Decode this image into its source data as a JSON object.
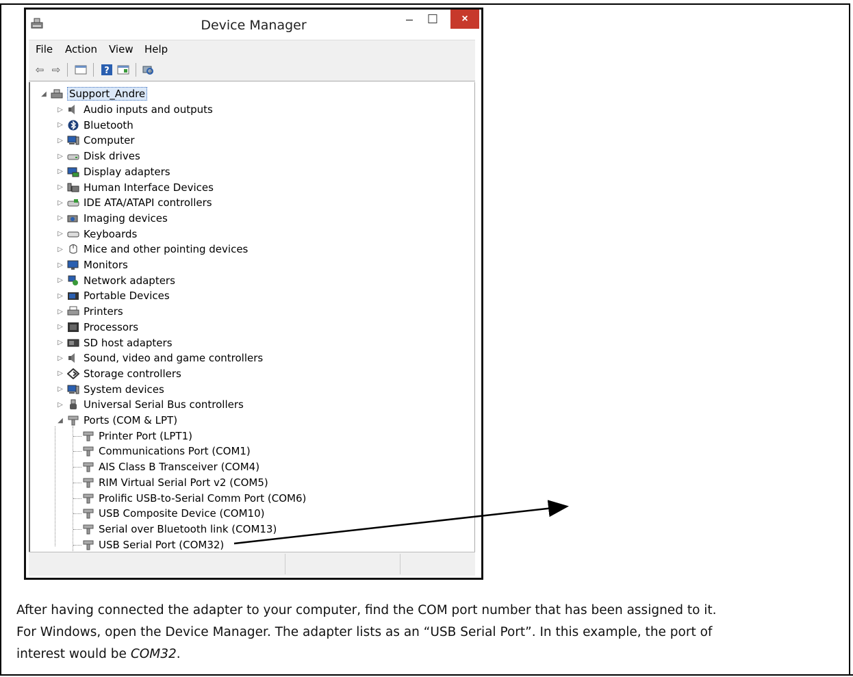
{
  "window": {
    "title": "Device Manager",
    "buttons": {
      "minimize": "–",
      "maximize": "☐",
      "close": "×"
    }
  },
  "menu": [
    "File",
    "Action",
    "View",
    "Help"
  ],
  "tree": {
    "root": "Support_Andre",
    "categories": [
      {
        "label": "Audio inputs and outputs",
        "icon": "speaker-icon"
      },
      {
        "label": "Bluetooth",
        "icon": "bluetooth-icon"
      },
      {
        "label": "Computer",
        "icon": "computer-icon"
      },
      {
        "label": "Disk drives",
        "icon": "disk-drive-icon"
      },
      {
        "label": "Display adapters",
        "icon": "display-adapter-icon"
      },
      {
        "label": "Human Interface Devices",
        "icon": "hid-icon"
      },
      {
        "label": "IDE ATA/ATAPI controllers",
        "icon": "ide-controller-icon"
      },
      {
        "label": "Imaging devices",
        "icon": "camera-icon"
      },
      {
        "label": "Keyboards",
        "icon": "keyboard-icon"
      },
      {
        "label": "Mice and other pointing devices",
        "icon": "mouse-icon"
      },
      {
        "label": "Monitors",
        "icon": "monitor-icon"
      },
      {
        "label": "Network adapters",
        "icon": "network-icon"
      },
      {
        "label": "Portable Devices",
        "icon": "portable-device-icon"
      },
      {
        "label": "Printers",
        "icon": "printer-icon"
      },
      {
        "label": "Processors",
        "icon": "processor-icon"
      },
      {
        "label": "SD host adapters",
        "icon": "sd-card-icon"
      },
      {
        "label": "Sound, video and game controllers",
        "icon": "speaker-icon"
      },
      {
        "label": "Storage controllers",
        "icon": "storage-icon"
      },
      {
        "label": "System devices",
        "icon": "computer-icon"
      },
      {
        "label": "Universal Serial Bus controllers",
        "icon": "usb-icon"
      }
    ],
    "ports": {
      "label": "Ports (COM & LPT)",
      "children": [
        "Printer Port (LPT1)",
        "Communications Port (COM1)",
        "AIS Class B Transceiver (COM4)",
        "RIM Virtual Serial Port v2 (COM5)",
        "Prolific USB-to-Serial Comm Port (COM6)",
        "USB Composite Device (COM10)",
        "Serial over Bluetooth link (COM13)",
        "USB Serial Port (COM32)"
      ]
    }
  },
  "caption": {
    "line1": "After having connected the adapter to your computer, find the COM port number that has been assigned to it.",
    "line2": "For Windows, open the Device Manager. The adapter lists as an “USB Serial Port”. In this example, the port of",
    "line3_prefix": "interest would be ",
    "line3_em": "COM32",
    "line3_suffix": "."
  },
  "colors": {
    "close_button": "#c7392b",
    "selection": "#dbe8f8",
    "chrome": "#f0f0f0"
  }
}
